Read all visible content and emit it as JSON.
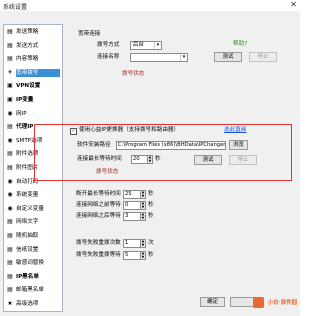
{
  "window": {
    "title": "系统设置",
    "close_glyph": "✕"
  },
  "nav": [
    {
      "icon": "▤",
      "label": "发送策略"
    },
    {
      "icon": "▤",
      "label": "发送方式"
    },
    {
      "icon": "▤",
      "label": "内容策略"
    },
    {
      "icon": "✈",
      "label": "宽带拨号",
      "selected": true
    },
    {
      "icon": "▣",
      "label": "VPN设置",
      "bold": true
    },
    {
      "icon": "▣",
      "label": "IP变量",
      "bold": true
    },
    {
      "icon": "◉",
      "label": "网IP"
    },
    {
      "icon": "▤",
      "label": "代理IP",
      "bold": true
    },
    {
      "icon": "◉",
      "label": "SMTP选项"
    },
    {
      "icon": "▤",
      "label": "附件选项"
    },
    {
      "icon": "▤",
      "label": "附件图片"
    },
    {
      "icon": "◉",
      "label": "自动打码"
    },
    {
      "icon": "◉",
      "label": "系统变量"
    },
    {
      "icon": "◉",
      "label": "自定义变量"
    },
    {
      "icon": "▤",
      "label": "网络文字"
    },
    {
      "icon": "▤",
      "label": "随机抽取"
    },
    {
      "icon": "▤",
      "label": "信纸设置"
    },
    {
      "icon": "▤",
      "label": "敏感词替换"
    },
    {
      "icon": "▤",
      "label": "IP黑名单",
      "bold": true
    },
    {
      "icon": "▤",
      "label": "邮箱黑名单"
    },
    {
      "icon": "★",
      "label": "高级选项"
    }
  ],
  "broadband": {
    "group_title": "宽带连接",
    "dial_mode_label": "拨号方式",
    "dial_mode_value": "后台",
    "help_link": "帮助?",
    "connection_label": "连接名称",
    "connection_value": "",
    "test_button": "测试",
    "stop_button": "停止",
    "status_text": "拨号状态"
  },
  "xinyi": {
    "checkbox_label": "使用心益IP更换器（支持拨号和路由器）",
    "checked": true,
    "download_link": "选此直阅",
    "path_label": "软件安装路径",
    "path_value": "C:\\Program Files (x86)\\BHData\\IPChanger",
    "browse_button": "浏览",
    "wait_label": "连接最长等待时间",
    "wait_value": "20",
    "wait_unit": "秒",
    "test_button": "测试",
    "stop_button": "停止",
    "status_text": "拨号状态"
  },
  "timing": [
    {
      "label": "断开最长等待时间",
      "value": "25",
      "unit": "秒"
    },
    {
      "label": "连接网络之前等待",
      "value": "0",
      "unit": "秒"
    },
    {
      "label": "连接网络之后等待",
      "value": "3",
      "unit": "秒"
    }
  ],
  "retry": [
    {
      "label": "拨号失败重拨次数",
      "value": "1",
      "unit": "次"
    },
    {
      "label": "拨号失败重拨等待",
      "value": "5",
      "unit": "秒"
    }
  ],
  "footer": {
    "ok_button": "确定",
    "watermark": "小白·软件园"
  }
}
